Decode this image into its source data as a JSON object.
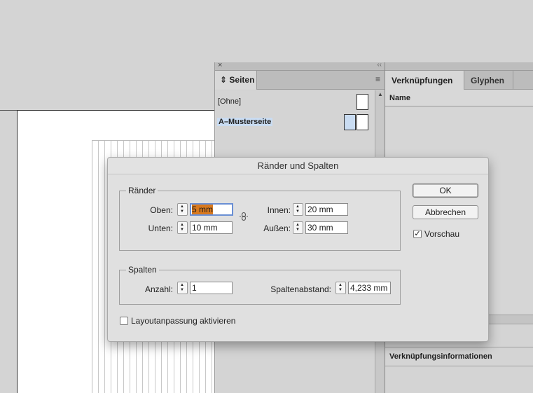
{
  "pages_panel": {
    "tab_label": "Seiten",
    "pages": [
      {
        "label": "[Ohne]",
        "selected": false
      },
      {
        "label": "A–Musterseite",
        "selected": true
      }
    ]
  },
  "links_panel": {
    "tabs": [
      "Verknüpfungen",
      "Glyphen"
    ],
    "column_header": "Name",
    "info_label": "Verknüpfungsinformationen"
  },
  "dialog": {
    "title": "Ränder und Spalten",
    "margins": {
      "legend": "Ränder",
      "oben_label": "Oben:",
      "oben_value": "5 mm",
      "unten_label": "Unten:",
      "unten_value": "10 mm",
      "innen_label": "Innen:",
      "innen_value": "20 mm",
      "aussen_label": "Außen:",
      "aussen_value": "30 mm"
    },
    "columns": {
      "legend": "Spalten",
      "anzahl_label": "Anzahl:",
      "anzahl_value": "1",
      "abstand_label": "Spaltenabstand:",
      "abstand_value": "4,233 mm"
    },
    "layout_adjust_label": "Layoutanpassung aktivieren",
    "layout_adjust_checked": false,
    "ok_label": "OK",
    "cancel_label": "Abbrechen",
    "preview_label": "Vorschau",
    "preview_checked": true
  },
  "colors": {
    "selection_highlight": "#d9791e",
    "focus_ring": "#6a8fd4",
    "selected_page": "#c9dcf2"
  }
}
